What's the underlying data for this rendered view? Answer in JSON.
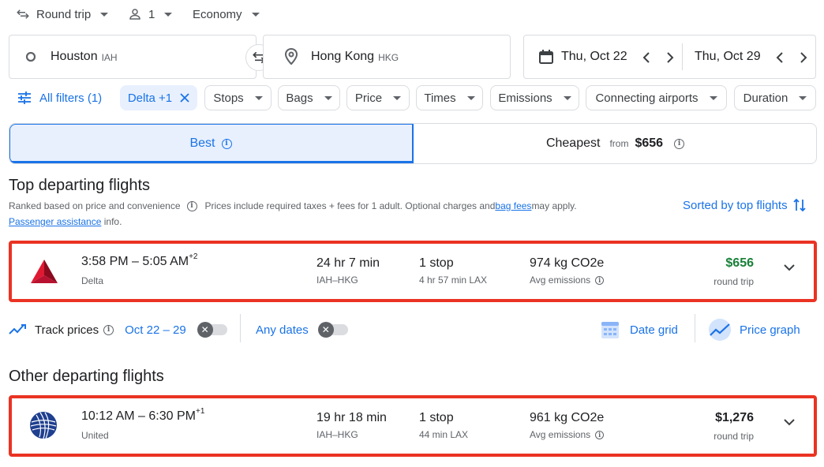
{
  "search": {
    "trip_type": "Round trip",
    "passengers": "1",
    "cabin": "Economy",
    "origin": {
      "city": "Houston",
      "code": "IAH"
    },
    "destination": {
      "city": "Hong Kong",
      "code": "HKG"
    },
    "depart_date": "Thu, Oct 22",
    "return_date": "Thu, Oct 29"
  },
  "filters": {
    "all_filters": "All filters (1)",
    "airline_chip": "Delta +1",
    "chips": [
      "Stops",
      "Bags",
      "Price",
      "Times",
      "Emissions",
      "Connecting airports",
      "Duration"
    ]
  },
  "tabs": {
    "best": "Best",
    "cheapest": "Cheapest",
    "cheapest_from": "from",
    "cheapest_price": "$656"
  },
  "top_section": {
    "title": "Top departing flights",
    "ranked_note": "Ranked based on price and convenience",
    "price_note_pre": "Prices include required taxes + fees for 1 adult. Optional charges and ",
    "bag_fees_link": "bag fees",
    "price_note_post": " may apply.",
    "assistance_link": "Passenger assistance",
    "assistance_post": " info.",
    "sort_label": "Sorted by top flights"
  },
  "flights_top": [
    {
      "depart": "3:58 PM",
      "arrive": "5:05 AM",
      "day_offset": "+2",
      "airline": "Delta",
      "duration": "24 hr 7 min",
      "route": "IAH–HKG",
      "stops": "1 stop",
      "layover": "4 hr 57 min LAX",
      "emissions": "974 kg CO2e",
      "emissions_note": "Avg emissions",
      "price": "$656",
      "price_color": "#188038",
      "price_note": "round trip"
    }
  ],
  "track": {
    "label": "Track prices",
    "dates": "Oct 22 – 29",
    "any_dates": "Any dates",
    "date_grid": "Date grid",
    "price_graph": "Price graph"
  },
  "other_section": {
    "title": "Other departing flights"
  },
  "flights_other": [
    {
      "depart": "10:12 AM",
      "arrive": "6:30 PM",
      "day_offset": "+1",
      "airline": "United",
      "duration": "19 hr 18 min",
      "route": "IAH–HKG",
      "stops": "1 stop",
      "layover": "44 min LAX",
      "emissions": "961 kg CO2e",
      "emissions_note": "Avg emissions",
      "price": "$1,276",
      "price_color": "#202124",
      "price_note": "round trip"
    }
  ],
  "colors": {
    "accent": "#1a73e8",
    "highlight_border": "#ea3323",
    "cheap_price": "#188038"
  }
}
